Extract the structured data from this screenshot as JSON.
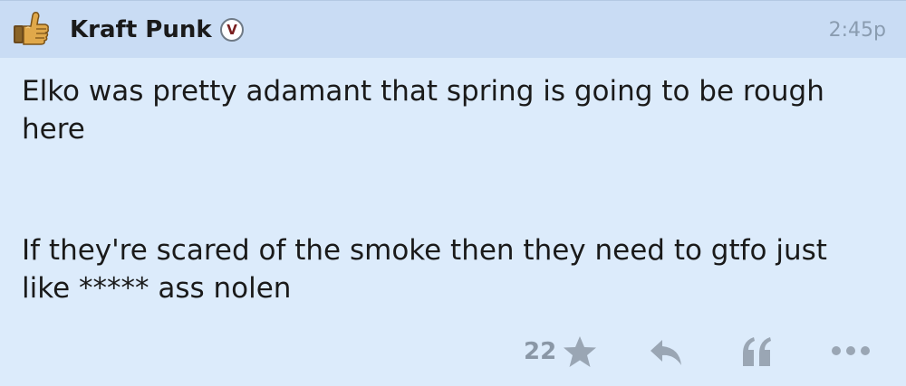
{
  "post": {
    "username": "Kraft Punk",
    "badge_letter": "V",
    "timestamp": "2:45p",
    "paragraphs": [
      "Elko was pretty adamant that spring is going to be rough here",
      "If they're scared of the smoke then they need to gtfo just like ***** ass nolen"
    ],
    "like_count": "22"
  },
  "icons": {
    "avatar": "thumbs-up-icon",
    "star": "star-icon",
    "reply": "reply-icon",
    "quote": "quote-icon",
    "more": "more-icon"
  },
  "colors": {
    "background": "#dcebfb",
    "header_background": "#c9dcf4",
    "icon_gray": "#9aa6b4",
    "badge_letter": "#7a1e1e"
  }
}
